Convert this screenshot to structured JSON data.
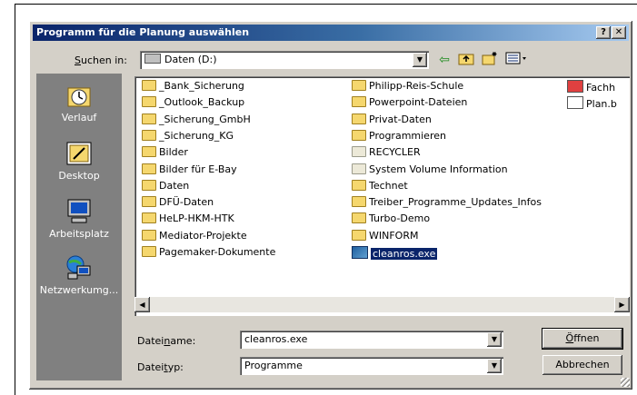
{
  "dialog": {
    "title": "Programm für die Planung auswählen",
    "help_label": "?",
    "close_label": "✕"
  },
  "lookin": {
    "label": "Suchen in:",
    "value": "Daten (D:)"
  },
  "places": [
    {
      "label": "Verlauf",
      "icon": "history-icon"
    },
    {
      "label": "Desktop",
      "icon": "desktop-icon"
    },
    {
      "label": "Arbeitsplatz",
      "icon": "my-computer-icon"
    },
    {
      "label": "Netzwerkumg...",
      "icon": "network-icon"
    }
  ],
  "files": {
    "col1": [
      "_Bank_Sicherung",
      "_Outlook_Backup",
      "_Sicherung_GmbH",
      "_Sicherung_KG",
      "Bilder",
      "Bilder für E-Bay",
      "Daten",
      "DFÜ-Daten",
      "HeLP-HKM-HTK",
      "Mediator-Projekte",
      "Pagemaker-Dokumente"
    ],
    "col2": [
      "Philipp-Reis-Schule",
      "Powerpoint-Dateien",
      "Privat-Daten",
      "Programmieren",
      "RECYCLER",
      "System Volume Information",
      "Technet",
      "Treiber_Programme_Updates_Infos",
      "Turbo-Demo",
      "WINFORM",
      "cleanros.exe"
    ],
    "col3": [
      "Fachh",
      "Plan.b"
    ]
  },
  "filename": {
    "label": "Dateiname:",
    "value": "cleanros.exe"
  },
  "filetype": {
    "label": "Dateityp:",
    "value": "Programme"
  },
  "buttons": {
    "open": "Öffnen",
    "cancel": "Abbrechen"
  },
  "colors": {
    "title_start": "#0a246a",
    "title_end": "#a6caf0",
    "face": "#d4d0c8",
    "places_bg": "#808080",
    "selection": "#0a246a"
  }
}
